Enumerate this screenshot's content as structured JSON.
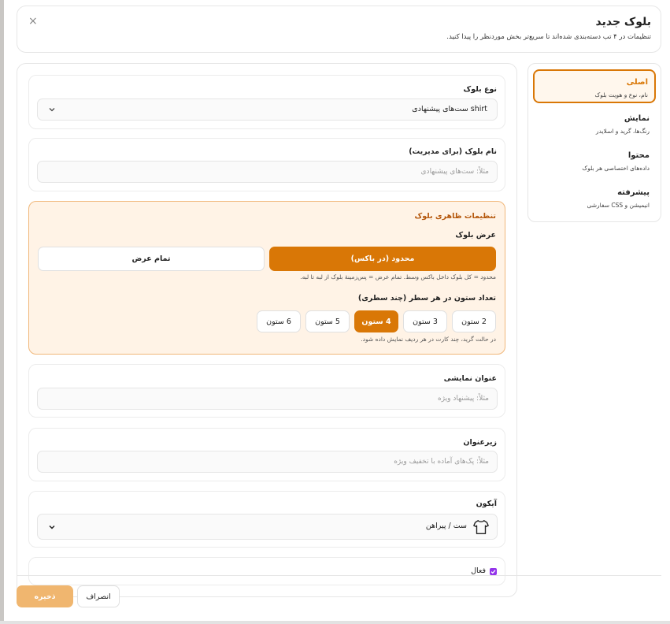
{
  "header": {
    "title": "بلوک جدید",
    "subtitle": "تنظیمات در ۴ تب دسته‌بندی شده‌اند تا سریع‌تر بخش موردنظر را پیدا کنید.",
    "close": "×"
  },
  "sidebar": {
    "items": [
      {
        "label": "اصلی",
        "desc": "نام، نوع و هویت بلوک"
      },
      {
        "label": "نمایش",
        "desc": "رنگ‌ها، گرید و اسلایدر"
      },
      {
        "label": "محتوا",
        "desc": "داده‌های اختصاصی هر بلوک"
      },
      {
        "label": "پیشرفته",
        "desc": "انیمیشن و CSS سفارشی"
      }
    ]
  },
  "block_type": {
    "label": "نوع بلوک",
    "value": "shirt ست‌های پیشنهادی"
  },
  "block_name": {
    "label": "نام بلوک (برای مدیریت)",
    "placeholder": "مثلاً: ست‌های پیشنهادی"
  },
  "appearance": {
    "title": "تنظیمات ظاهری بلوک",
    "width_label": "عرض بلوک",
    "width_options": [
      "محدود (در باکس)",
      "تمام عرض"
    ],
    "width_hint": "محدود = کل بلوک داخل باکس وسط. تمام عرض = پس‌زمینهٔ بلوک از لبه تا لبه.",
    "columns_label": "تعداد ستون در هر سطر (چند سطری)",
    "column_options": [
      "2 ستون",
      "3 ستون",
      "4 ستون",
      "5 ستون",
      "6 ستون"
    ],
    "columns_hint": "در حالت گرید، چند کارت در هر ردیف نمایش داده شود."
  },
  "display_title": {
    "label": "عنوان نمایشی",
    "placeholder": "مثلاً: پیشنهاد ویژه"
  },
  "subtitle_field": {
    "label": "زیرعنوان",
    "placeholder": "مثلاً: پک‌های آماده با تخفیف ویژه"
  },
  "icon_field": {
    "label": "آیکون",
    "value": "ست / پیراهن",
    "icon": "shirt-icon"
  },
  "active": {
    "label": "فعال",
    "checked": true
  },
  "footer": {
    "save": "ذخیره",
    "cancel": "انصراف"
  },
  "colors": {
    "accent": "#d97706",
    "accent_light": "#fff3e6",
    "check": "#9333ea"
  }
}
